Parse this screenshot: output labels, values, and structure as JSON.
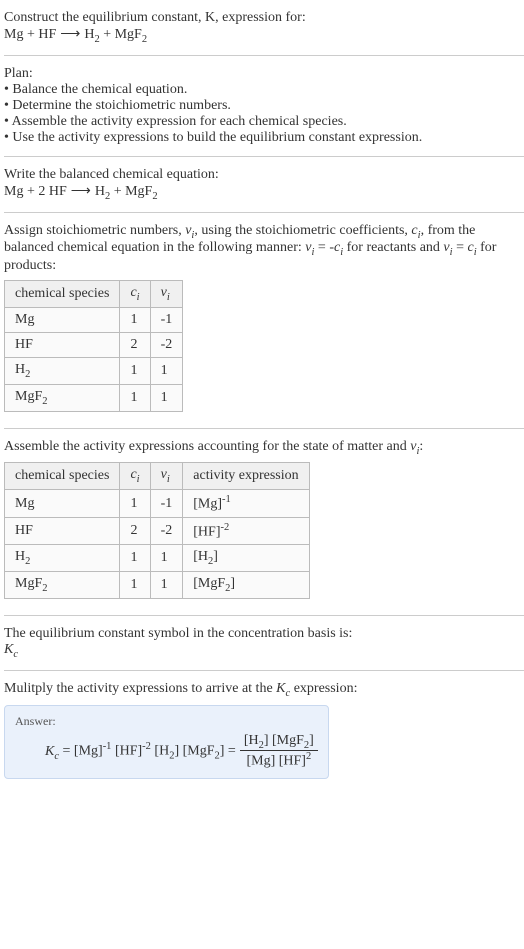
{
  "intro": {
    "line1": "Construct the equilibrium constant, K, expression for:",
    "equation_text": "Mg + HF ⟶ H₂ + MgF₂"
  },
  "plan": {
    "heading": "Plan:",
    "bullets": [
      "• Balance the chemical equation.",
      "• Determine the stoichiometric numbers.",
      "• Assemble the activity expression for each chemical species.",
      "• Use the activity expressions to build the equilibrium constant expression."
    ]
  },
  "balanced": {
    "heading": "Write the balanced chemical equation:",
    "equation_text": "Mg + 2 HF ⟶ H₂ + MgF₂"
  },
  "assign": {
    "text_before": "Assign stoichiometric numbers, νᵢ, using the stoichiometric coefficients, cᵢ, from the balanced chemical equation in the following manner: νᵢ = -cᵢ for reactants and νᵢ = cᵢ for products:",
    "headers": [
      "chemical species",
      "cᵢ",
      "νᵢ"
    ],
    "rows": [
      [
        "Mg",
        "1",
        "-1"
      ],
      [
        "HF",
        "2",
        "-2"
      ],
      [
        "H₂",
        "1",
        "1"
      ],
      [
        "MgF₂",
        "1",
        "1"
      ]
    ]
  },
  "activity": {
    "heading": "Assemble the activity expressions accounting for the state of matter and νᵢ:",
    "headers": [
      "chemical species",
      "cᵢ",
      "νᵢ",
      "activity expression"
    ],
    "rows": [
      [
        "Mg",
        "1",
        "-1",
        "[Mg]⁻¹"
      ],
      [
        "HF",
        "2",
        "-2",
        "[HF]⁻²"
      ],
      [
        "H₂",
        "1",
        "1",
        "[H₂]"
      ],
      [
        "MgF₂",
        "1",
        "1",
        "[MgF₂]"
      ]
    ]
  },
  "kc_symbol": {
    "line1": "The equilibrium constant symbol in the concentration basis is:",
    "line2": "K_c"
  },
  "multiply": {
    "heading": "Mulitply the activity expressions to arrive at the K_c expression:"
  },
  "answer": {
    "label": "Answer:",
    "lhs": "K_c = [Mg]⁻¹ [HF]⁻² [H₂] [MgF₂] =",
    "num": "[H₂] [MgF₂]",
    "den": "[Mg] [HF]²"
  },
  "chart_data": {
    "type": "table",
    "tables": [
      {
        "title": "Stoichiometric numbers",
        "columns": [
          "chemical species",
          "c_i",
          "nu_i"
        ],
        "rows": [
          {
            "chemical species": "Mg",
            "c_i": 1,
            "nu_i": -1
          },
          {
            "chemical species": "HF",
            "c_i": 2,
            "nu_i": -2
          },
          {
            "chemical species": "H2",
            "c_i": 1,
            "nu_i": 1
          },
          {
            "chemical species": "MgF2",
            "c_i": 1,
            "nu_i": 1
          }
        ]
      },
      {
        "title": "Activity expressions",
        "columns": [
          "chemical species",
          "c_i",
          "nu_i",
          "activity expression"
        ],
        "rows": [
          {
            "chemical species": "Mg",
            "c_i": 1,
            "nu_i": -1,
            "activity expression": "[Mg]^-1"
          },
          {
            "chemical species": "HF",
            "c_i": 2,
            "nu_i": -2,
            "activity expression": "[HF]^-2"
          },
          {
            "chemical species": "H2",
            "c_i": 1,
            "nu_i": 1,
            "activity expression": "[H2]"
          },
          {
            "chemical species": "MgF2",
            "c_i": 1,
            "nu_i": 1,
            "activity expression": "[MgF2]"
          }
        ]
      }
    ],
    "balanced_equation": "Mg + 2 HF -> H2 + MgF2",
    "Kc_expression": "Kc = ([H2][MgF2]) / ([Mg][HF]^2)"
  }
}
